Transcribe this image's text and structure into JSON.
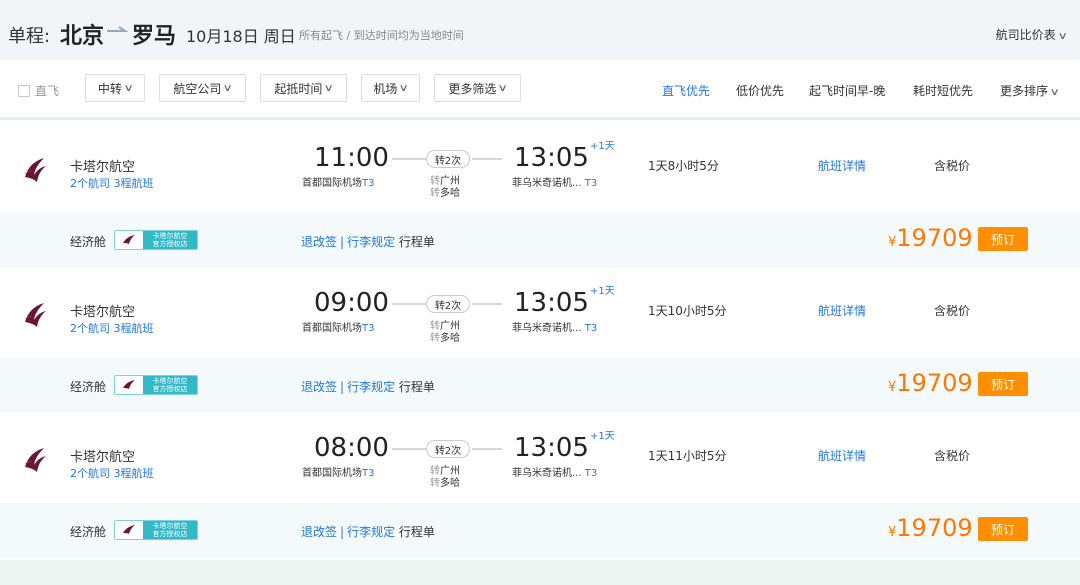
{
  "header": {
    "single_label": "单程:",
    "from_city": "北京",
    "to_city": "罗马",
    "date": "10月18日 周日",
    "note": "所有起飞 / 到达时间均为当地时间",
    "compare": "航司比价表"
  },
  "filters": {
    "direct_label": "直飞",
    "dropdowns": [
      "中转",
      "航空公司",
      "起抵时间",
      "机场",
      "更多筛选"
    ],
    "sorts": [
      "直飞优先",
      "低价优先",
      "起飞时间早-晚",
      "耗时短优先",
      "更多排序"
    ]
  },
  "colors": {
    "accent": "#2577e3",
    "price": "#ff7700",
    "book": "#ff8f00",
    "header_bg": "#f2f4f7",
    "cabin_row_bg": "#f4f9fb"
  },
  "flights": [
    {
      "airline": "卡塔尔航空",
      "airline_sub": "2个航司  3程航班",
      "dep_time": "11:00",
      "dep_airport": "首都国际机场",
      "dep_terminal": "T3",
      "stops": "转2次",
      "via1_k": "转",
      "via1": "广州",
      "via2_k": "转",
      "via2": "多哈",
      "arr_time": "13:05",
      "plus_day": "+1天",
      "arr_airport": "菲乌米奇诺机...",
      "arr_terminal": "T3",
      "duration": "1天8小时5分",
      "detail": "航班详情",
      "tax": "含税价",
      "cabin": "经济舱",
      "badge_line1": "卡塔尔航空",
      "badge_line2": "官方授权店",
      "link1": "退改签",
      "link2": "行李规定",
      "link3": "行程单",
      "currency": "¥",
      "price": "19709",
      "book": "预订"
    },
    {
      "airline": "卡塔尔航空",
      "airline_sub": "2个航司  3程航班",
      "dep_time": "09:00",
      "dep_airport": "首都国际机场",
      "dep_terminal": "T3",
      "stops": "转2次",
      "via1_k": "转",
      "via1": "广州",
      "via2_k": "转",
      "via2": "多哈",
      "arr_time": "13:05",
      "plus_day": "+1天",
      "arr_airport": "菲乌米奇诺机...",
      "arr_terminal": "T3",
      "duration": "1天10小时5分",
      "detail": "航班详情",
      "tax": "含税价",
      "cabin": "经济舱",
      "badge_line1": "卡塔尔航空",
      "badge_line2": "官方授权店",
      "link1": "退改签",
      "link2": "行李规定",
      "link3": "行程单",
      "currency": "¥",
      "price": "19709",
      "book": "预订"
    },
    {
      "airline": "卡塔尔航空",
      "airline_sub": "2个航司  3程航班",
      "dep_time": "08:00",
      "dep_airport": "首都国际机场",
      "dep_terminal": "T3",
      "stops": "转2次",
      "via1_k": "转",
      "via1": "广州",
      "via2_k": "转",
      "via2": "多哈",
      "arr_time": "13:05",
      "plus_day": "+1天",
      "arr_airport": "菲乌米奇诺机...",
      "arr_terminal": "T3",
      "duration": "1天11小时5分",
      "detail": "航班详情",
      "tax": "含税价",
      "cabin": "经济舱",
      "badge_line1": "卡塔尔航空",
      "badge_line2": "官方授权店",
      "link1": "退改签",
      "link2": "行李规定",
      "link3": "行程单",
      "currency": "¥",
      "price": "19709",
      "book": "预订"
    }
  ]
}
